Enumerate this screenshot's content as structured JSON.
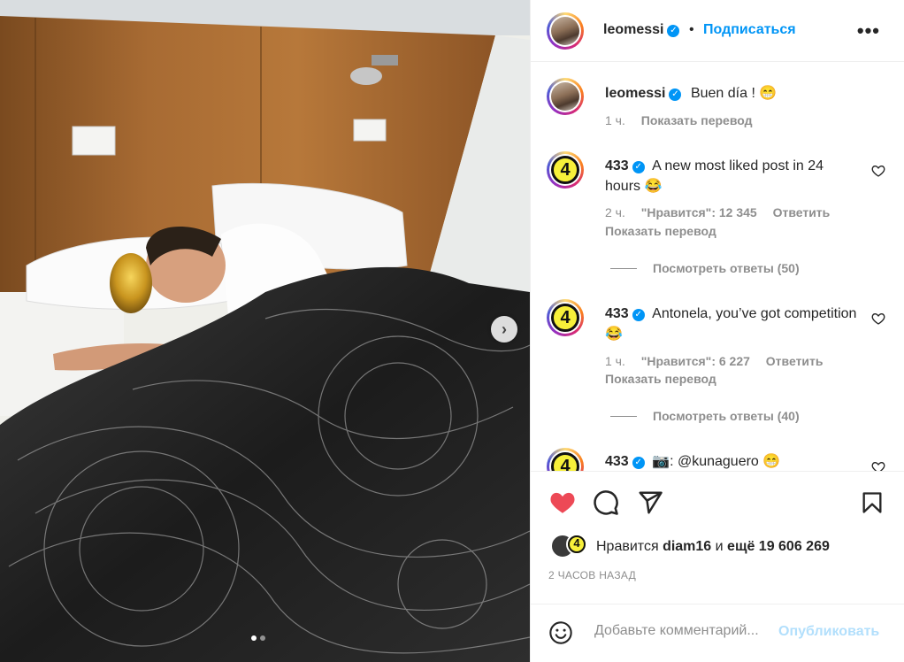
{
  "post": {
    "author": "leomessi",
    "follow_label": "Подписаться",
    "more_label": "•••",
    "caption": "Buen día ! 😁",
    "caption_time": "1 ч.",
    "caption_translate": "Показать перевод"
  },
  "comments": [
    {
      "author": "433",
      "avatar_text": "4",
      "text": "A new most liked post in 24 hours 😂",
      "time": "2 ч.",
      "likes": "\"Нравится\": 12 345",
      "reply": "Ответить",
      "translate": "Показать перевод",
      "view_replies": "Посмотреть ответы (50)"
    },
    {
      "author": "433",
      "avatar_text": "4",
      "text": "Antonela, you’ve got competition 😂",
      "time": "1 ч.",
      "likes": "\"Нравится\": 6 227",
      "reply": "Ответить",
      "translate": "Показать перевод",
      "view_replies": "Посмотреть ответы (40)"
    },
    {
      "author": "433",
      "avatar_text": "4",
      "text": "📷: @kunaguero 😁"
    }
  ],
  "likes_summary": {
    "prefix": "Нравится",
    "user": "diam16",
    "and": "и",
    "rest": "ещё 19 606 269",
    "avatar_text": "4"
  },
  "timestamp": "2 ЧАСОВ НАЗАД",
  "add_comment": {
    "placeholder": "Добавьте комментарий...",
    "publish_label": "Опубликовать"
  },
  "carousel": {
    "next_label": "›"
  },
  "colors": {
    "accent": "#0095f6",
    "like_red": "#ed4956",
    "secondary_text": "#8e8e8e"
  }
}
